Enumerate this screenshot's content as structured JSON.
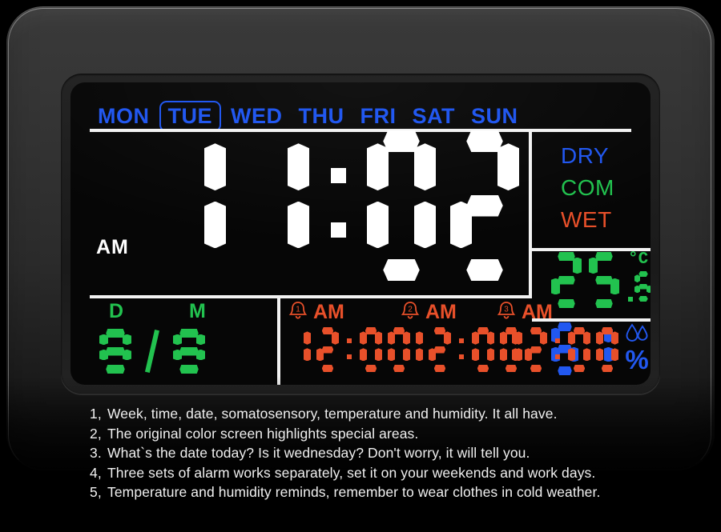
{
  "device": {
    "name": "digital-alarm-clock",
    "colors": {
      "blue": "#2258f0",
      "green": "#22c24f",
      "orange": "#e8502a",
      "white": "#ffffff",
      "lcd_background": "#060606",
      "bezel": "#333333"
    }
  },
  "weekdays": [
    {
      "label": "MON",
      "active": false
    },
    {
      "label": "TUE",
      "active": true
    },
    {
      "label": "WED",
      "active": false
    },
    {
      "label": "THU",
      "active": false
    },
    {
      "label": "FRI",
      "active": false
    },
    {
      "label": "SAT",
      "active": false
    },
    {
      "label": "SUN",
      "active": false
    }
  ],
  "time": {
    "meridiem": "AM",
    "hours": "11",
    "minutes": "02",
    "separator": ":",
    "display": "11:02"
  },
  "comfort": {
    "dry_label": "DRY",
    "com_label": "COM",
    "wet_label": "WET",
    "active": "COM"
  },
  "temperature": {
    "value": "25",
    "decimal": "6",
    "unit": "°C",
    "unit_icon": "degree-celsius-icon",
    "display": "25.6"
  },
  "humidity": {
    "value": "61",
    "unit": "%",
    "icon": "water-droplet-icon",
    "display": "61%"
  },
  "date": {
    "d_label": "D",
    "m_label": "M",
    "day": "8",
    "month": "8",
    "separator": "/",
    "display": "8/8"
  },
  "alarms": [
    {
      "bell_icon": "alarm-bell-1-icon",
      "number": "1",
      "meridiem": "AM",
      "time": "12:00"
    },
    {
      "bell_icon": "alarm-bell-2-icon",
      "number": "2",
      "meridiem": "AM",
      "time": "12:00"
    },
    {
      "bell_icon": "alarm-bell-3-icon",
      "number": "3",
      "meridiem": "AM",
      "time": "12:00"
    }
  ],
  "caption": {
    "lines": [
      {
        "num": "1,",
        "text": "Week, time, date, somatosensory, temperature and humidity. It all have."
      },
      {
        "num": "2,",
        "text": "The original color screen highlights special areas."
      },
      {
        "num": "3.",
        "text": "What`s the date today? Is it wednesday? Don't worry, it will tell you."
      },
      {
        "num": "4,",
        "text": "Three sets of alarm works separately, set it on your weekends and work days."
      },
      {
        "num": "5,",
        "text": "Temperature and humidity reminds,   remember to wear clothes in cold weather."
      }
    ]
  }
}
